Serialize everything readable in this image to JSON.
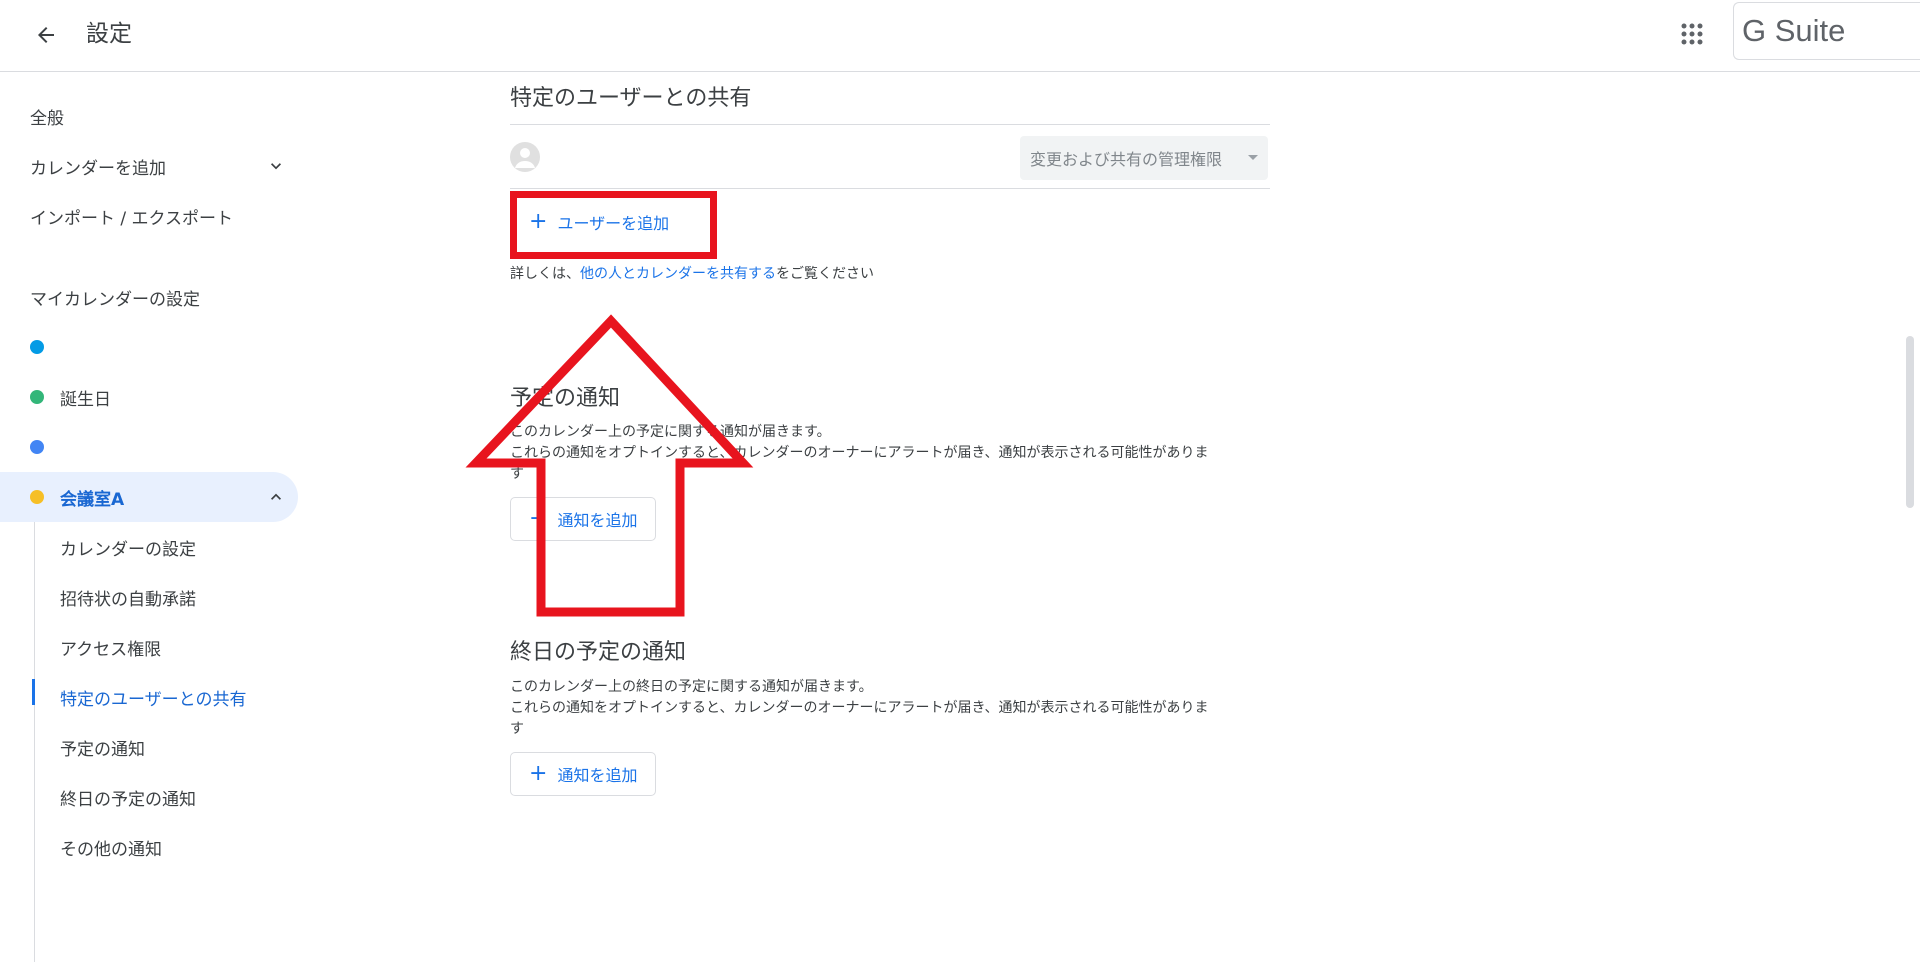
{
  "header": {
    "title": "設定",
    "brand": "G Suite"
  },
  "sidebar": {
    "general": "全般",
    "add_calendar": "カレンダーを追加",
    "import_export": "インポート / エクスポート",
    "my_calendars_title": "マイカレンダーの設定",
    "calendars": [
      {
        "label": "",
        "color": "#039be5"
      },
      {
        "label": "誕生日",
        "color": "#33b679"
      },
      {
        "label": "",
        "color": "#4285f4"
      },
      {
        "label": "会議室A",
        "color": "#f6bf26"
      }
    ],
    "sub_items": [
      "カレンダーの設定",
      "招待状の自動承諾",
      "アクセス権限",
      "特定のユーザーとの共有",
      "予定の通知",
      "終日の予定の通知",
      "その他の通知"
    ]
  },
  "sharing": {
    "title": "特定のユーザーとの共有",
    "permission": "変更および共有の管理権限",
    "add_user": "ユーザーを追加",
    "learn_prefix": "詳しくは、",
    "learn_link": "他の人とカレンダーを共有する",
    "learn_suffix": "をご覧ください"
  },
  "event_notifications": {
    "title": "予定の通知",
    "line1": "このカレンダー上の予定に関する通知が届きます。",
    "line2": "これらの通知をオプトインすると、カレンダーのオーナーにアラートが届き、通知が表示される可能性がありま",
    "line3": "す",
    "add": "通知を追加"
  },
  "allday_notifications": {
    "title": "終日の予定の通知",
    "line1": "このカレンダー上の終日の予定に関する通知が届きます。",
    "line2": "これらの通知をオプトインすると、カレンダーのオーナーにアラートが届き、通知が表示される可能性がありま",
    "line3": "す",
    "add": "通知を追加"
  },
  "colors": {
    "accent": "#1a73e8",
    "annotation": "#e8141e"
  }
}
